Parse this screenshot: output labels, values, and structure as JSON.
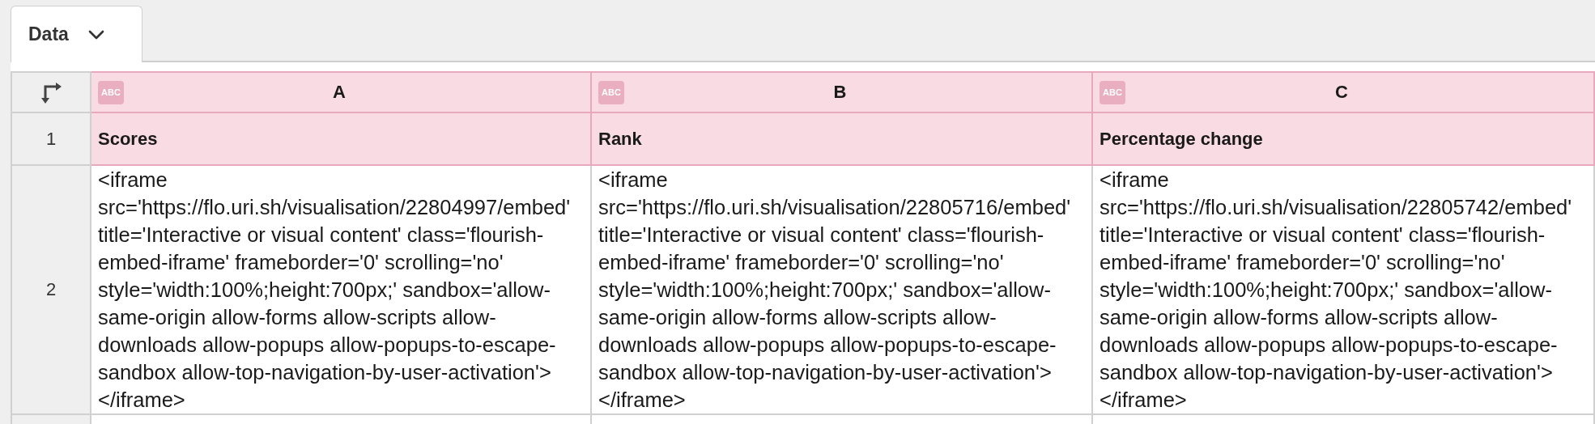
{
  "tabs": [
    {
      "label": "Data",
      "selected": true
    }
  ],
  "table": {
    "columns": [
      {
        "letter": "A",
        "type_label": "ABC"
      },
      {
        "letter": "B",
        "type_label": "ABC"
      },
      {
        "letter": "C",
        "type_label": "ABC"
      }
    ],
    "rows": [
      {
        "number": "1",
        "kind": "header",
        "cells": [
          "Scores",
          "Rank",
          "Percentage change"
        ]
      },
      {
        "number": "2",
        "kind": "data",
        "cells": [
          "<iframe src='https://flo.uri.sh/visualisation/22804997/embed' title='Interactive or visual content' class='flourish-embed-iframe' frameborder='0' scrolling='no' style='width:100%;height:700px;' sandbox='allow-same-origin allow-forms allow-scripts allow-downloads allow-popups allow-popups-to-escape-sandbox allow-top-navigation-by-user-activation'></iframe>",
          "<iframe src='https://flo.uri.sh/visualisation/22805716/embed' title='Interactive or visual content' class='flourish-embed-iframe' frameborder='0' scrolling='no' style='width:100%;height:700px;' sandbox='allow-same-origin allow-forms allow-scripts allow-downloads allow-popups allow-popups-to-escape-sandbox allow-top-navigation-by-user-activation'></iframe>",
          "<iframe src='https://flo.uri.sh/visualisation/22805742/embed' title='Interactive or visual content' class='flourish-embed-iframe' frameborder='0' scrolling='no' style='width:100%;height:700px;' sandbox='allow-same-origin allow-forms allow-scripts allow-downloads allow-popups allow-popups-to-escape-sandbox allow-top-navigation-by-user-activation'></iframe>"
        ]
      }
    ]
  }
}
